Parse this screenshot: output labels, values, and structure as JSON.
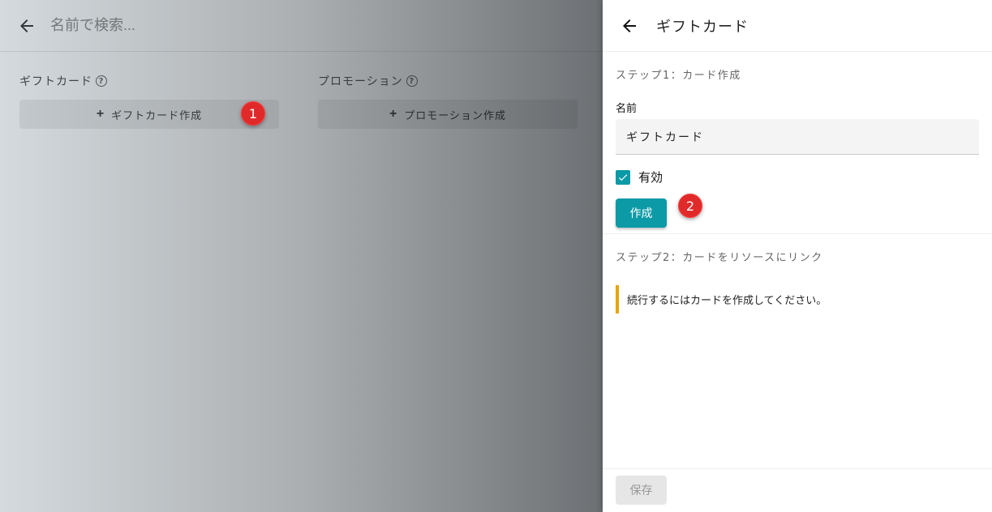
{
  "base": {
    "search_placeholder": "名前で検索...",
    "sections": [
      {
        "title": "ギフトカード",
        "button": "ギフトカード作成"
      },
      {
        "title": "プロモーション",
        "button": "プロモーション作成"
      }
    ]
  },
  "badges": [
    "1",
    "2"
  ],
  "panel": {
    "title": "ギフトカード",
    "step1": "ステップ1：カード作成",
    "name_label": "名前",
    "name_value": "ギフトカード",
    "enabled_label": "有効",
    "enabled": true,
    "create_button": "作成",
    "step2": "ステップ2：カードをリソースにリンク",
    "notice": "続行するにはカードを作成してください。",
    "save_button": "保存"
  },
  "colors": {
    "accent": "#0c9aa6",
    "warning": "#e5a50a",
    "badge": "#e02a2a"
  }
}
